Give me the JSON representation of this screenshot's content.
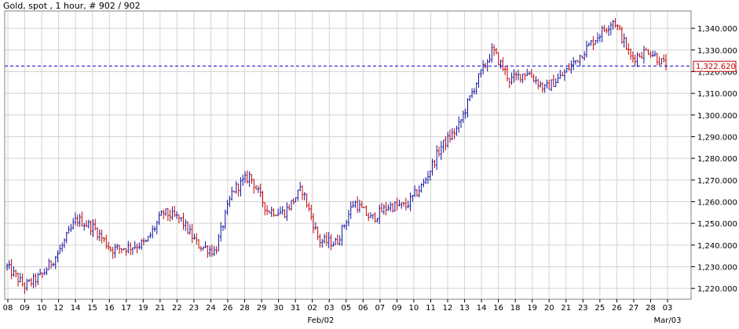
{
  "title": "Gold, spot , 1 hour, # 902 / 902",
  "colors": {
    "background": "#ffffff",
    "grid": "#d4d4d4",
    "frame": "#808080",
    "bar_up": "#1010a0",
    "bar_down": "#c00000",
    "current_line": "#0000c8",
    "price_tag": "#c00000"
  },
  "chart_data": {
    "type": "candlestick",
    "title": "Gold, spot , 1 hour, # 902 / 902",
    "x_tick_labels": [
      "08",
      "09",
      "10",
      "12",
      "14",
      "15",
      "16",
      "17",
      "19",
      "21",
      "22",
      "23",
      "24",
      "26",
      "28",
      "29",
      "30",
      "31",
      "02",
      "03",
      "05",
      "06",
      "07",
      "09",
      "10",
      "11",
      "12",
      "13",
      "14",
      "16",
      "18",
      "19",
      "20",
      "21",
      "23",
      "25",
      "26",
      "27",
      "28",
      "03"
    ],
    "x_month_labels": [
      "Feb/02",
      "Mar/03"
    ],
    "y_tick_labels": [
      "1,220.000",
      "1,230.000",
      "1,240.000",
      "1,250.000",
      "1,260.000",
      "1,270.000",
      "1,280.000",
      "1,290.000",
      "1,300.000",
      "1,310.000",
      "1,320.000",
      "1,330.000",
      "1,340.000"
    ],
    "ylim": [
      1215,
      1348
    ],
    "current_price": 1322.62,
    "current_price_label": "1,322.620",
    "anchors": [
      [
        0,
        1230
      ],
      [
        1,
        1221
      ],
      [
        2,
        1226
      ],
      [
        3,
        1237
      ],
      [
        4,
        1252
      ],
      [
        5,
        1248
      ],
      [
        6,
        1238
      ],
      [
        7,
        1239
      ],
      [
        8,
        1241
      ],
      [
        9,
        1255
      ],
      [
        10,
        1252
      ],
      [
        11,
        1240
      ],
      [
        12,
        1237
      ],
      [
        13,
        1265
      ],
      [
        14,
        1272
      ],
      [
        15,
        1256
      ],
      [
        16,
        1255
      ],
      [
        17,
        1266
      ],
      [
        18,
        1242
      ],
      [
        19,
        1241
      ],
      [
        20,
        1260
      ],
      [
        21,
        1252
      ],
      [
        22,
        1258
      ],
      [
        23,
        1258
      ],
      [
        24,
        1268
      ],
      [
        25,
        1285
      ],
      [
        26,
        1294
      ],
      [
        27,
        1314
      ],
      [
        28,
        1330
      ],
      [
        29,
        1316
      ],
      [
        30,
        1320
      ],
      [
        31,
        1312
      ],
      [
        32,
        1318
      ],
      [
        33,
        1327
      ],
      [
        34,
        1336
      ],
      [
        35,
        1344
      ],
      [
        36,
        1326
      ],
      [
        37,
        1330
      ],
      [
        38,
        1322.62
      ]
    ]
  }
}
